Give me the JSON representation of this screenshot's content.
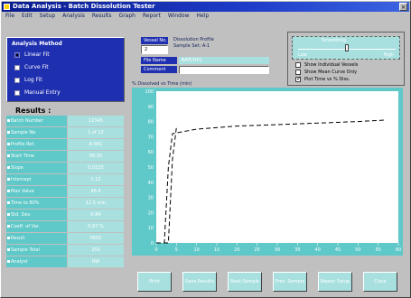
{
  "window": {
    "title": "Data Analysis - Batch Dissolution Tester",
    "close_label": "×"
  },
  "menu": [
    "File",
    "Edit",
    "Setup",
    "Analysis",
    "Results",
    "Graph",
    "Report",
    "Window",
    "Help"
  ],
  "method": {
    "group_title": "Analysis Method",
    "options": [
      {
        "label": "Linear Fit",
        "selected": true
      },
      {
        "label": "Curve Fit",
        "selected": false
      },
      {
        "label": "Log Fit",
        "selected": false
      },
      {
        "label": "Manual Entry",
        "selected": false
      }
    ]
  },
  "results": {
    "title": "Results :",
    "rows": [
      {
        "label": "Batch Number",
        "value": "12345"
      },
      {
        "label": "Sample No.",
        "value": "1 of 12"
      },
      {
        "label": "Profile Ref.",
        "value": "A-001"
      },
      {
        "label": "Start Time",
        "value": "08:30"
      },
      {
        "label": "Slope",
        "value": "0.0235"
      },
      {
        "label": "Intercept",
        "value": "1.12"
      },
      {
        "label": "Max Value",
        "value": "96.4"
      },
      {
        "label": "Time to 80%",
        "value": "12.5 min"
      },
      {
        "label": "Std. Dev.",
        "value": "0.84"
      },
      {
        "label": "Coeff. of Var.",
        "value": "0.87 %"
      },
      {
        "label": "Result",
        "value": "PASS"
      },
      {
        "label": "Sample Total",
        "value": "250"
      },
      {
        "label": "Analyst",
        "value": "RW"
      }
    ]
  },
  "fields": {
    "vessel_label": "Vessel No.",
    "vessel_value": "2",
    "profile_text": "Dissolution Profile",
    "profile_sub": "Sample Set: A-1",
    "filename_label": "File Name",
    "filename_value": "BATCH01",
    "comment_label": "Comment"
  },
  "options": {
    "title": "Smoothing",
    "low_label": "Low",
    "high_label": "High",
    "level": 0.5,
    "checks": [
      {
        "label": "Show Individual Vessels",
        "checked": false
      },
      {
        "label": "Show Mean Curve Only",
        "checked": false
      },
      {
        "label": "Plot Time vs % Diss.",
        "checked": true
      }
    ]
  },
  "chart_header": "% Dissolved vs Time (min)",
  "chart_data": {
    "type": "line",
    "xlim": [
      0,
      60
    ],
    "ylim": [
      0,
      100
    ],
    "x_ticks": [
      "0",
      "5",
      "10",
      "15",
      "20",
      "25",
      "30",
      "35",
      "40",
      "45",
      "50",
      "55",
      "60"
    ],
    "y_ticks": [
      "100",
      "90",
      "80",
      "70",
      "60",
      "50",
      "40",
      "30",
      "20",
      "10",
      "0"
    ],
    "series": [
      {
        "values_x": [
          0,
          2,
          3,
          4,
          10,
          20,
          30,
          40,
          50,
          57
        ],
        "values_y": [
          0,
          0,
          50,
          72,
          75,
          77,
          78,
          79,
          80,
          81
        ]
      },
      {
        "values_x": [
          0,
          3,
          4,
          5
        ],
        "values_y": [
          0,
          0,
          55,
          76
        ]
      }
    ],
    "colors": {
      "plot_bg": "#ffffff",
      "frame": "#5fc8c8",
      "line": "#000000"
    }
  },
  "buttons": [
    "Print",
    "Save Results",
    "Next Sample",
    "Prev. Sample",
    "Report Setup",
    "Close"
  ]
}
